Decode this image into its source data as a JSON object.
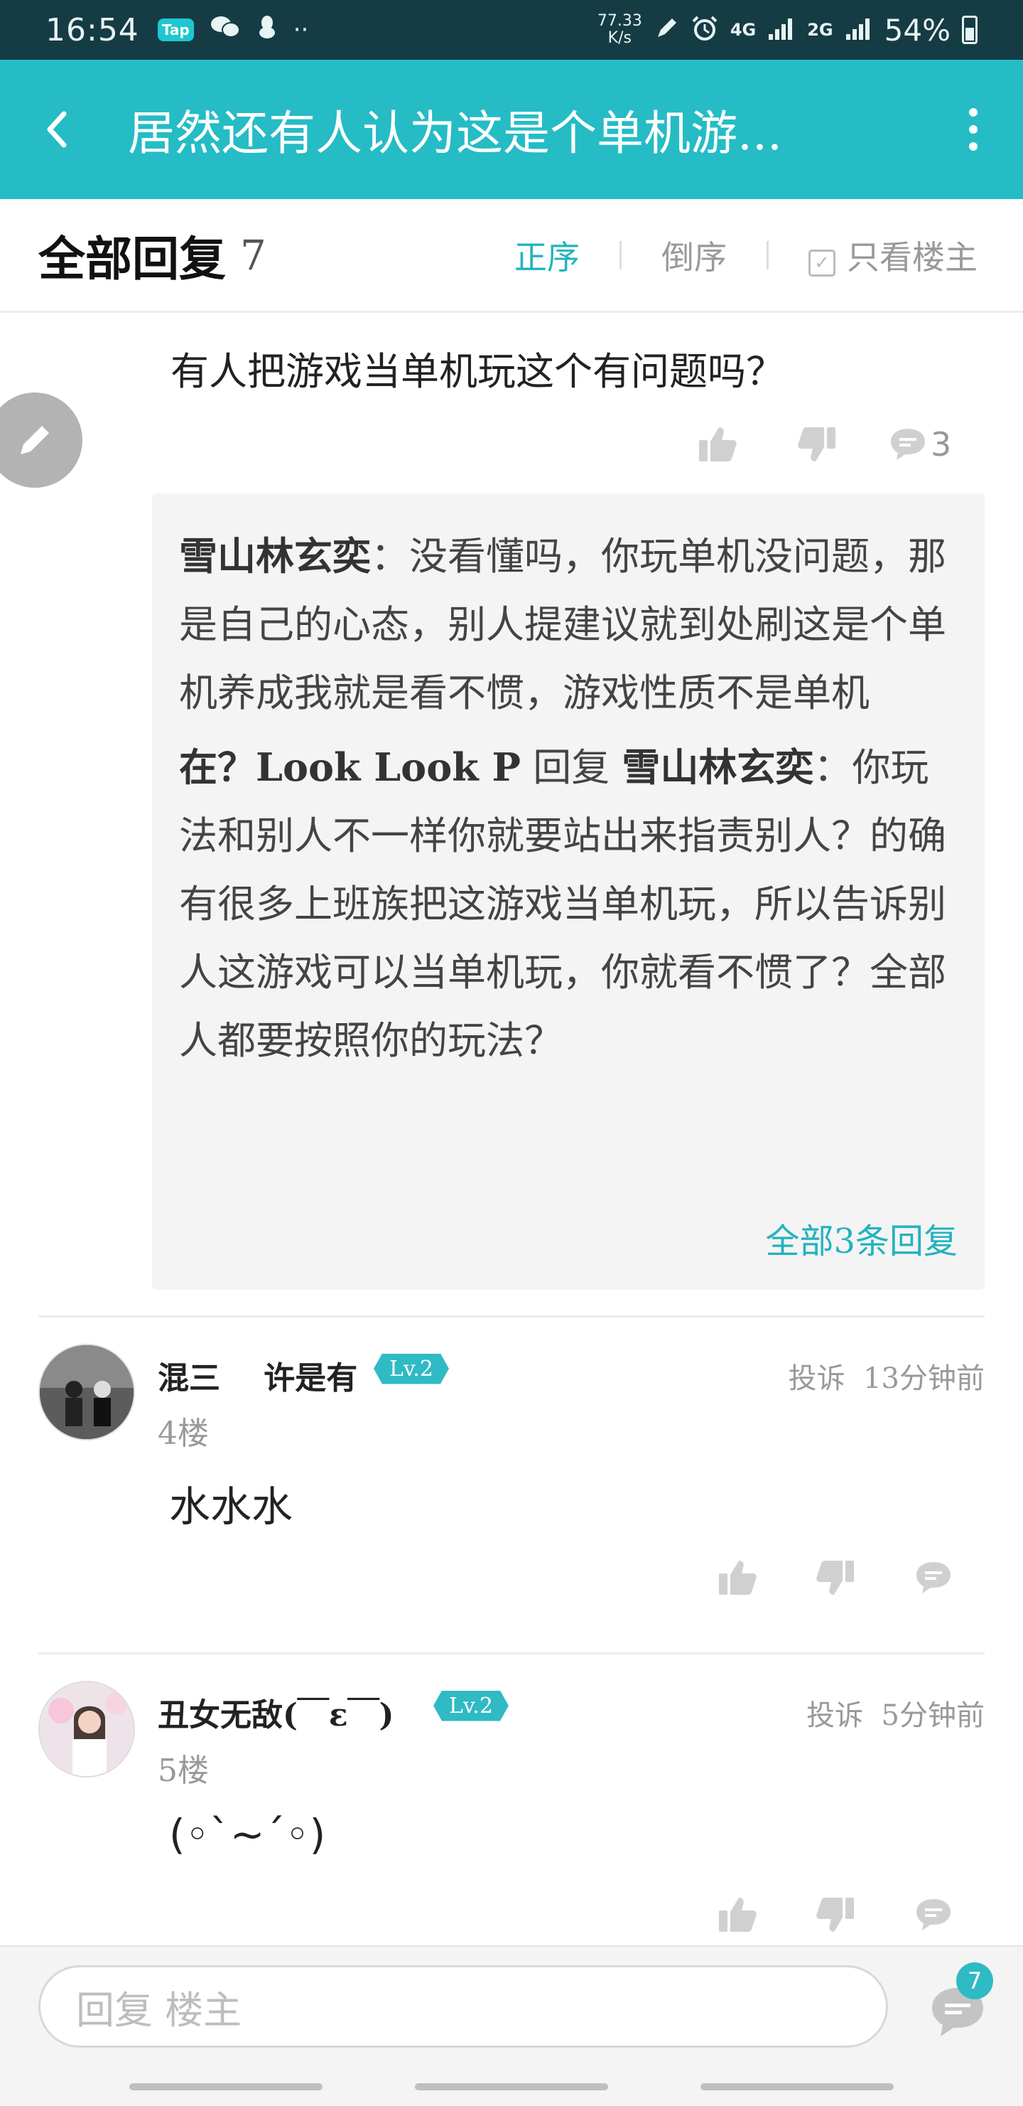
{
  "status_bar": {
    "time": "16:54",
    "app_badge": "Tap",
    "more": "··",
    "speed_value": "77.33",
    "speed_unit": "K/s",
    "network_4g": "4G",
    "network_2g": "2G",
    "battery": "54%"
  },
  "header": {
    "title": "居然还有人认为这是个单机游..."
  },
  "reply_bar": {
    "title": "全部回复",
    "count": "7",
    "sort_asc": "正序",
    "sort_desc": "倒序",
    "only_op": "只看楼主"
  },
  "post": {
    "text": "有人把游戏当单机玩这个有问题吗？",
    "comment_count": "3"
  },
  "sub_replies": [
    {
      "name": "雪山林玄奕",
      "text": "：没看懂吗，你玩单机没问题，那是自己的心态，别人提建议就到处刷这是个单机养成我就是看不惯，游戏性质不是单机"
    },
    {
      "name": "在？Look Look P",
      "reply_word": " 回复 ",
      "reply_to": "雪山林玄奕",
      "text": "：你玩法和别人不一样你就要站出来指责别人？的确有很多上班族把这游戏当单机玩，所以告诉别人这游戏可以当单机玩，你就看不惯了？全部人都要按照你的玩法？"
    }
  ],
  "sub_all_link": "全部3条回复",
  "comments": [
    {
      "name": "混三    许是有",
      "level": "Lv.2",
      "report": "投诉",
      "time": "13分钟前",
      "floor": "4楼",
      "text": "水水水"
    },
    {
      "name": "丑女无敌(￣ε￣)",
      "level": "Lv.2",
      "report": "投诉",
      "time": "5分钟前",
      "floor": "5楼",
      "text": "(◦`~´◦)"
    }
  ],
  "bottom_bar": {
    "placeholder": "回复  楼主",
    "badge": "7"
  },
  "colors": {
    "accent": "#25bcc5",
    "status_bar": "#153c44"
  }
}
